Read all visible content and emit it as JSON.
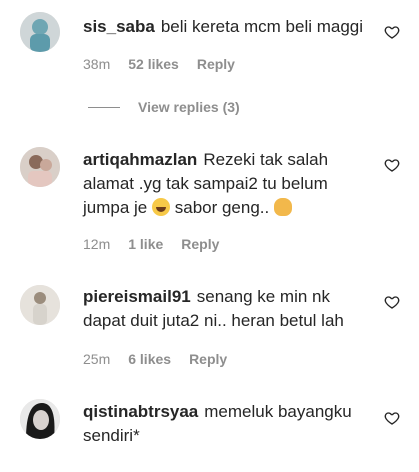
{
  "comments": [
    {
      "username": "sis_saba",
      "text": "beli kereta mcm beli maggi",
      "time": "38m",
      "likes": "52 likes",
      "reply": "Reply"
    },
    {
      "username": "artiqahmazlan",
      "text_before_emoji": "Rezeki tak salah alamat .yg tak sampai2 tu belum jumpa je",
      "text_middle": "sabor geng..",
      "time": "12m",
      "likes": "1 like",
      "reply": "Reply"
    },
    {
      "username": "piereismail91",
      "text": "senang ke min nk dapat duit juta2 ni.. heran betul lah",
      "time": "25m",
      "likes": "6 likes",
      "reply": "Reply"
    },
    {
      "username": "qistinabtrsyaa",
      "text": "memeluk bayangku sendiri*"
    }
  ],
  "view_replies": "View replies (3)",
  "icons": {
    "like": "heart-outline-icon",
    "emoji_1": "face-with-tears-of-joy-emoji",
    "emoji_2": "clapping-hands-emoji"
  }
}
